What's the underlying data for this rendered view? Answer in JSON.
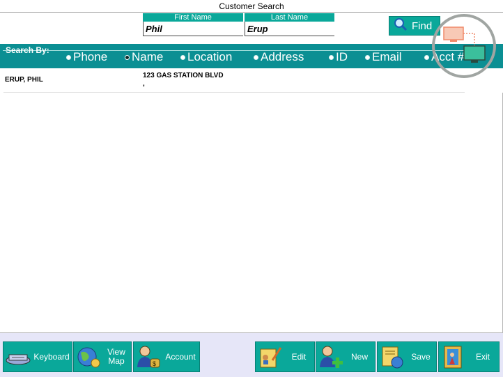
{
  "window": {
    "title": "Customer Search"
  },
  "search_form": {
    "first_name_label": "First Name",
    "first_name_value": "Phil",
    "last_name_label": "Last Name",
    "last_name_value": "Erup",
    "find_label": "Find",
    "find_icon": "magnifier-icon"
  },
  "search_by": {
    "label": "Search By:",
    "options": [
      "Phone",
      "Name",
      "Location",
      "Address",
      "ID",
      "Email",
      "Acct #"
    ],
    "selected": "Name"
  },
  "results": [
    {
      "name": "ERUP, PHIL",
      "address_line1": "123 GAS STATION BLVD",
      "address_line2": ","
    }
  ],
  "bottom_buttons": [
    {
      "label": "Keyboard",
      "icon": "keyboard-icon"
    },
    {
      "label_line1": "View",
      "label_line2": "Map",
      "icon": "globe-map-icon"
    },
    {
      "label": "Account",
      "icon": "account-icon"
    },
    {
      "label": "Edit",
      "icon": "edit-icon"
    },
    {
      "label": "New",
      "icon": "new-customer-icon"
    },
    {
      "label": "Save",
      "icon": "save-icon"
    },
    {
      "label": "Exit",
      "icon": "exit-door-icon"
    }
  ],
  "colors": {
    "teal": "#0aa89a",
    "search_bar": "#0b8f93",
    "bottom_bg": "#e6e6f8"
  }
}
